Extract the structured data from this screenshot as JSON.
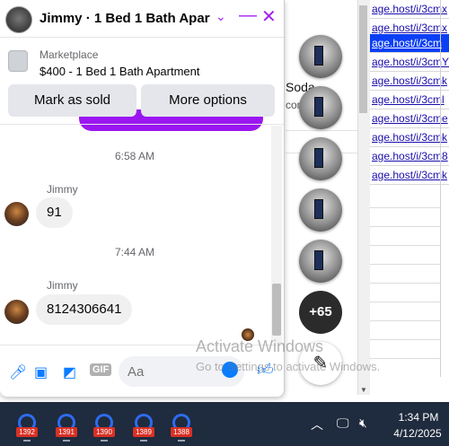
{
  "chat": {
    "title": "Jimmy · 1 Bed 1 Bath Apart…",
    "marketplace_label": "Marketplace",
    "listing_title": "$400 - 1 Bed 1 Bath Apartment",
    "mark_sold_label": "Mark as sold",
    "more_options_label": "More options",
    "messages": [
      {
        "timestamp": "6:58 AM",
        "sender": "Jimmy",
        "text": "91"
      },
      {
        "timestamp": "7:44 AM",
        "sender": "Jimmy",
        "text": "8124306641"
      }
    ],
    "input_placeholder": "Aa",
    "gif_label": "GIF",
    "accent_color": "#a020f0",
    "messenger_blue": "#0a7cff"
  },
  "chat_heads": {
    "more_count": "+65"
  },
  "underlying_page": {
    "text_fragment": "Soda",
    "text_fragment_2": "con",
    "sheet_links": [
      "age.host/i/3cmx",
      "age.host/i/3cmx",
      "age.host/i/3cm",
      "age.host/i/3cmY",
      "age.host/i/3cmk",
      "age.host/i/3cml",
      "age.host/i/3cme",
      "age.host/i/3cmk",
      "age.host/i/3cm8",
      "age.host/i/3cmk"
    ]
  },
  "watermark": {
    "line1": "Activate Windows",
    "line2": "Go to Settings to activate Windows."
  },
  "taskbar": {
    "app_badges": [
      "1392",
      "1391",
      "1390",
      "1389",
      "1388"
    ],
    "time": "1:34 PM",
    "date": "4/12/2025"
  }
}
